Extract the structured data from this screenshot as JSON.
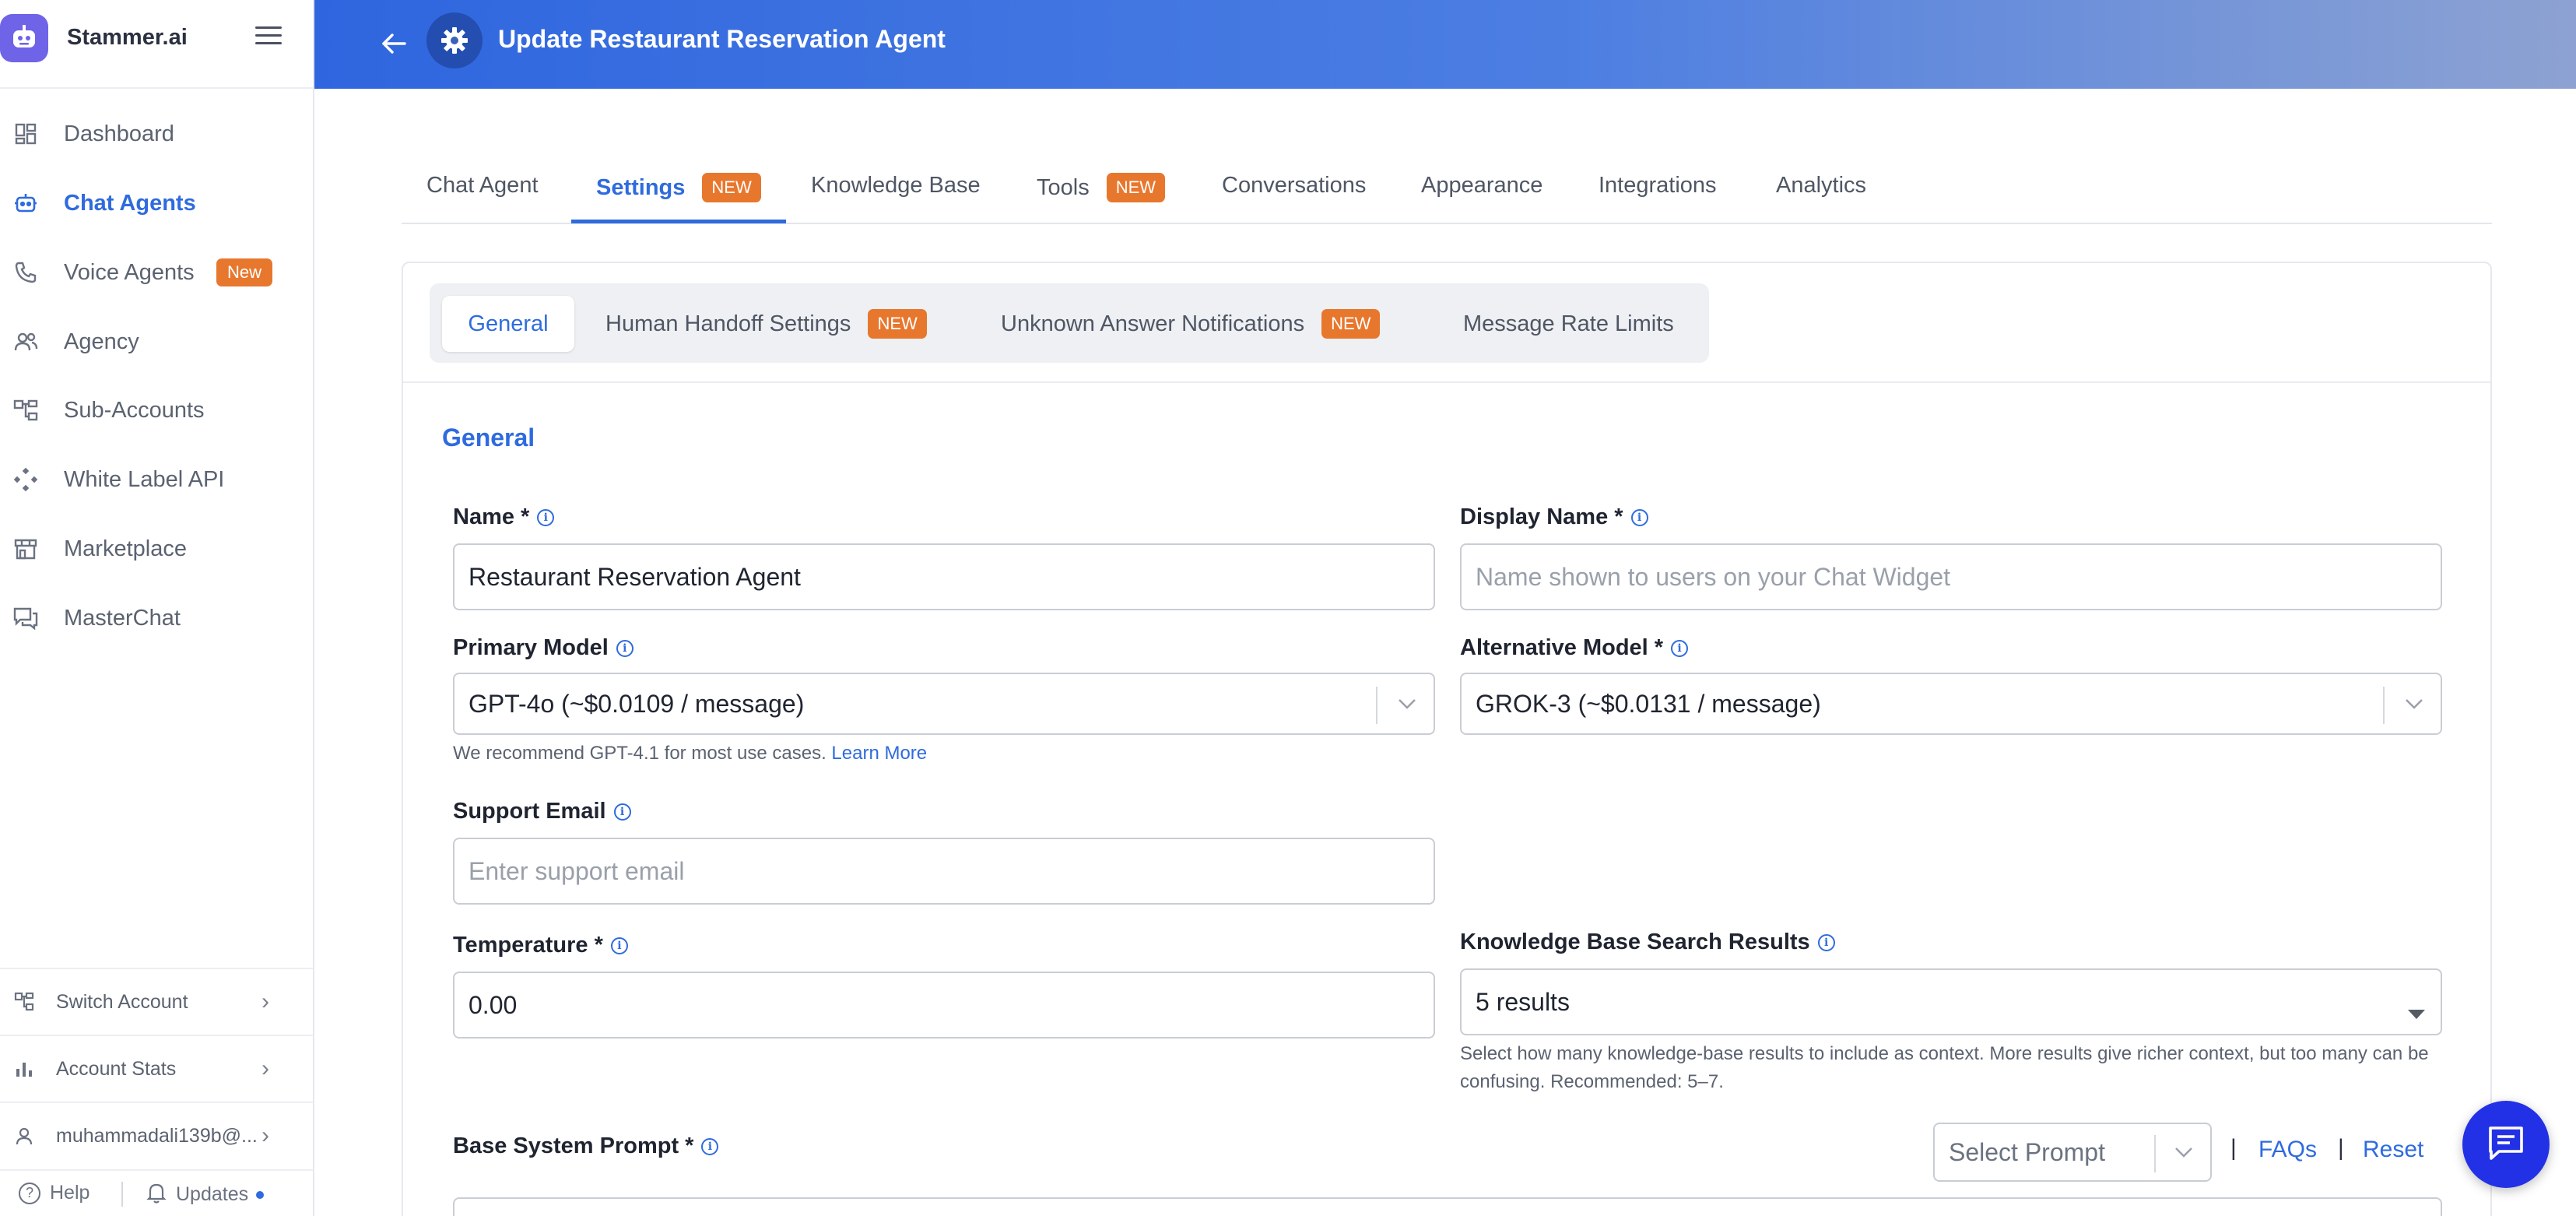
{
  "app": {
    "name": "Stammer.ai",
    "title": "Update Restaurant Reservation Agent"
  },
  "sidebar": {
    "items": [
      {
        "label": "Dashboard",
        "icon": "dashboard-icon"
      },
      {
        "label": "Chat Agents",
        "icon": "robot-icon",
        "active": true
      },
      {
        "label": "Voice Agents",
        "icon": "phone-icon",
        "badge": "New"
      },
      {
        "label": "Agency",
        "icon": "users-icon"
      },
      {
        "label": "Sub-Accounts",
        "icon": "hierarchy-icon"
      },
      {
        "label": "White Label API",
        "icon": "api-icon"
      },
      {
        "label": "Marketplace",
        "icon": "store-icon"
      },
      {
        "label": "MasterChat",
        "icon": "chat-bubbles-icon"
      }
    ],
    "footer": {
      "switch_account": "Switch Account",
      "account_stats": "Account Stats",
      "user": "muhammadali139b@...",
      "help": "Help",
      "updates": "Updates"
    }
  },
  "tabs": [
    {
      "label": "Chat Agent"
    },
    {
      "label": "Settings",
      "badge": "NEW",
      "active": true
    },
    {
      "label": "Knowledge Base"
    },
    {
      "label": "Tools",
      "badge": "NEW"
    },
    {
      "label": "Conversations"
    },
    {
      "label": "Appearance"
    },
    {
      "label": "Integrations"
    },
    {
      "label": "Analytics"
    }
  ],
  "subtabs": [
    {
      "label": "General",
      "active": true
    },
    {
      "label": "Human Handoff Settings",
      "badge": "NEW"
    },
    {
      "label": "Unknown Answer Notifications",
      "badge": "NEW"
    },
    {
      "label": "Message Rate Limits"
    }
  ],
  "form": {
    "section_title": "General",
    "name": {
      "label": "Name *",
      "value": "Restaurant Reservation Agent"
    },
    "display_name": {
      "label": "Display Name *",
      "placeholder": "Name shown to users on your Chat Widget"
    },
    "primary_model": {
      "label": "Primary Model",
      "value": "GPT-4o (~$0.0109 / message)",
      "hint": "We recommend GPT-4.1 for most use cases.",
      "hint_link": "Learn More"
    },
    "alternative_model": {
      "label": "Alternative Model *",
      "value": "GROK-3 (~$0.0131 / message)"
    },
    "support_email": {
      "label": "Support Email",
      "placeholder": "Enter support email"
    },
    "temperature": {
      "label": "Temperature *",
      "value": "0.00"
    },
    "kb_results": {
      "label": "Knowledge Base Search Results",
      "value": "5 results",
      "hint": "Select how many knowledge-base results to include as context. More results give richer context, but too many can be confusing. Recommended: 5–7."
    },
    "base_prompt": {
      "label": "Base System Prompt *",
      "select_placeholder": "Select Prompt",
      "separator": "|",
      "faqs": "FAQs",
      "reset": "Reset"
    }
  },
  "colors": {
    "accent": "#2f6bde",
    "badge": "#e8772e",
    "fab": "#2331e6"
  }
}
